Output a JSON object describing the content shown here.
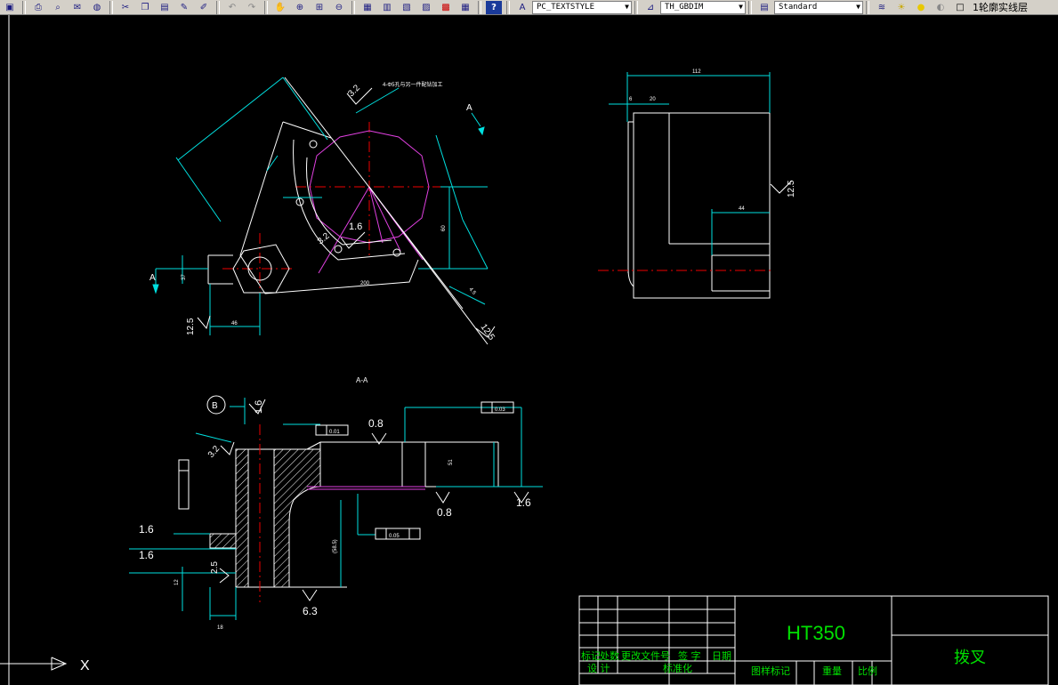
{
  "toolbar": {
    "text_style": "PC_TEXTSTYLE",
    "dim_style": "TH_GBDIM",
    "table_style": "Standard",
    "layer": "1轮廓实线层"
  },
  "drawing": {
    "section_label": "A-A",
    "view_mark": "A",
    "datum_label": "B",
    "top_note": "4-Φ5孔与另一件配钻加工",
    "roughness": {
      "r16": "1.6",
      "r08": "0.8",
      "r63": "6.3",
      "r125": "12.5",
      "r32": "3.2",
      "r25": "2.5"
    },
    "tolerances": {
      "parallel": "0.03",
      "perp": "0.05",
      "flat": "0.01"
    },
    "dims": {
      "d37": "37",
      "d46": "46",
      "d60": "60",
      "d80": "80",
      "d112": "112",
      "d44": "44",
      "d51": "51",
      "d18": "18",
      "d12": "12",
      "d6": "6",
      "d200": "200",
      "d45": "4.5",
      "d20": "20",
      "d58": "(58.5)"
    },
    "title_block": {
      "material": "HT350",
      "part_name": "拨叉",
      "rows_left": [
        "标记",
        "处数",
        "更改文件号",
        "签 字",
        "日期"
      ],
      "row_design": [
        "设 计",
        "标准化"
      ],
      "row_right": [
        "图样标记",
        "重量",
        "比例"
      ]
    },
    "ucs": "X"
  }
}
